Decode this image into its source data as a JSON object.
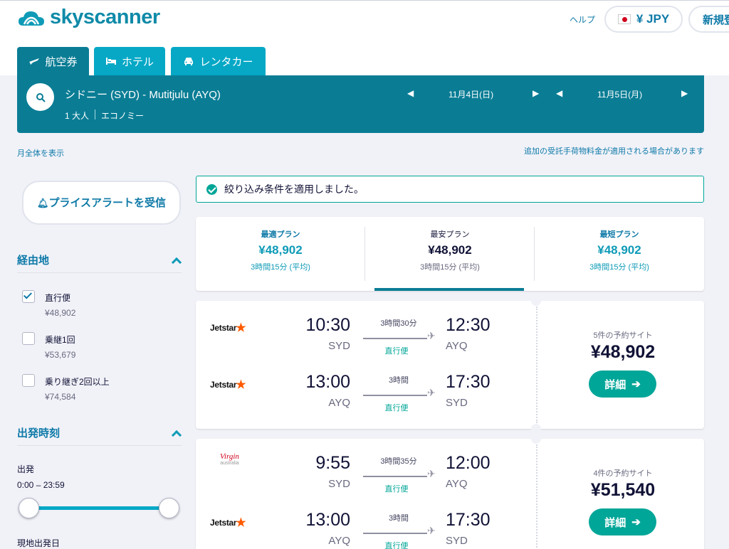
{
  "header": {
    "logo_text": "skyscanner",
    "help": "ヘルプ",
    "currency": "¥ JPY",
    "signup": "新規登録"
  },
  "tabs": [
    {
      "label": "航空券",
      "icon": "plane-icon",
      "active": true
    },
    {
      "label": "ホテル",
      "icon": "bed-icon"
    },
    {
      "label": "レンタカー",
      "icon": "car-icon"
    }
  ],
  "search": {
    "route": "シドニー (SYD) - Mutitjulu (AYQ)",
    "passengers": "1 大人",
    "cabin": "エコノミー",
    "depart_date": "11月4日(日)",
    "return_date": "11月5日(月)"
  },
  "links": {
    "month_view": "月全体を表示",
    "baggage_notice": "追加の受託手荷物料金が適用される場合があります"
  },
  "sidebar": {
    "price_alert": "プライスアラートを受信",
    "stops_title": "経由地",
    "stops": [
      {
        "label": "直行便",
        "price": "¥48,902",
        "checked": true
      },
      {
        "label": "乗継1回",
        "price": "¥53,679",
        "checked": false
      },
      {
        "label": "乗り継ぎ2回以上",
        "price": "¥74,584",
        "checked": false
      }
    ],
    "times_title": "出発時刻",
    "departure_label": "出発",
    "departure_range": "0:00 – 23:59",
    "local_date_label": "現地出発日"
  },
  "notice": "絞り込み条件を適用しました。",
  "sort": [
    {
      "label": "最適プラン",
      "price": "¥48,902",
      "duration": "3時間15分 (平均)"
    },
    {
      "label": "最安プラン",
      "price": "¥48,902",
      "duration": "3時間15分 (平均)",
      "active": true
    },
    {
      "label": "最短プラン",
      "price": "¥48,902",
      "duration": "3時間15分 (平均)"
    }
  ],
  "results": [
    {
      "legs": [
        {
          "airline": "Jetstar",
          "dep_time": "10:30",
          "dep_code": "SYD",
          "duration": "3時間30分",
          "stops": "直行便",
          "arr_time": "12:30",
          "arr_code": "AYQ"
        },
        {
          "airline": "Jetstar",
          "dep_time": "13:00",
          "dep_code": "AYQ",
          "duration": "3時間",
          "stops": "直行便",
          "arr_time": "17:30",
          "arr_code": "SYD"
        }
      ],
      "sites": "5件の予約サイト",
      "price": "¥48,902",
      "button": "詳細"
    },
    {
      "legs": [
        {
          "airline": "Virgin australia",
          "dep_time": "9:55",
          "dep_code": "SYD",
          "duration": "3時間35分",
          "stops": "直行便",
          "arr_time": "12:00",
          "arr_code": "AYQ"
        },
        {
          "airline": "Jetstar",
          "dep_time": "13:00",
          "dep_code": "AYQ",
          "duration": "3時間",
          "stops": "直行便",
          "arr_time": "17:30",
          "arr_code": "SYD"
        }
      ],
      "sites": "4件の予約サイト",
      "price": "¥51,540",
      "button": "詳細"
    }
  ],
  "colors": {
    "brand": "#0a7d95",
    "accent": "#06a8c6",
    "cta": "#00a698"
  }
}
